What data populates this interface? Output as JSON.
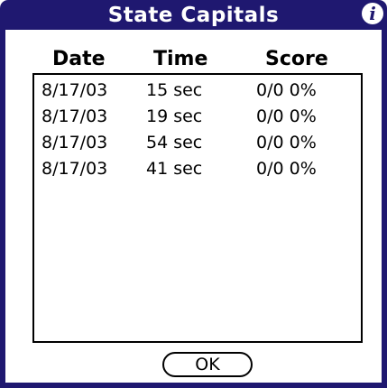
{
  "title": "State Capitals",
  "info_icon": "info-icon",
  "columns": {
    "date": "Date",
    "time": "Time",
    "score": "Score"
  },
  "rows": [
    {
      "date": "8/17/03",
      "time": "15 sec",
      "score": "0/0 0%"
    },
    {
      "date": "8/17/03",
      "time": "19 sec",
      "score": "0/0 0%"
    },
    {
      "date": "8/17/03",
      "time": "54 sec",
      "score": "0/0 0%"
    },
    {
      "date": "8/17/03",
      "time": "41 sec",
      "score": "0/0 0%"
    }
  ],
  "ok_label": "OK",
  "colors": {
    "title_bar": "#1f1870",
    "background": "#ffffff"
  }
}
